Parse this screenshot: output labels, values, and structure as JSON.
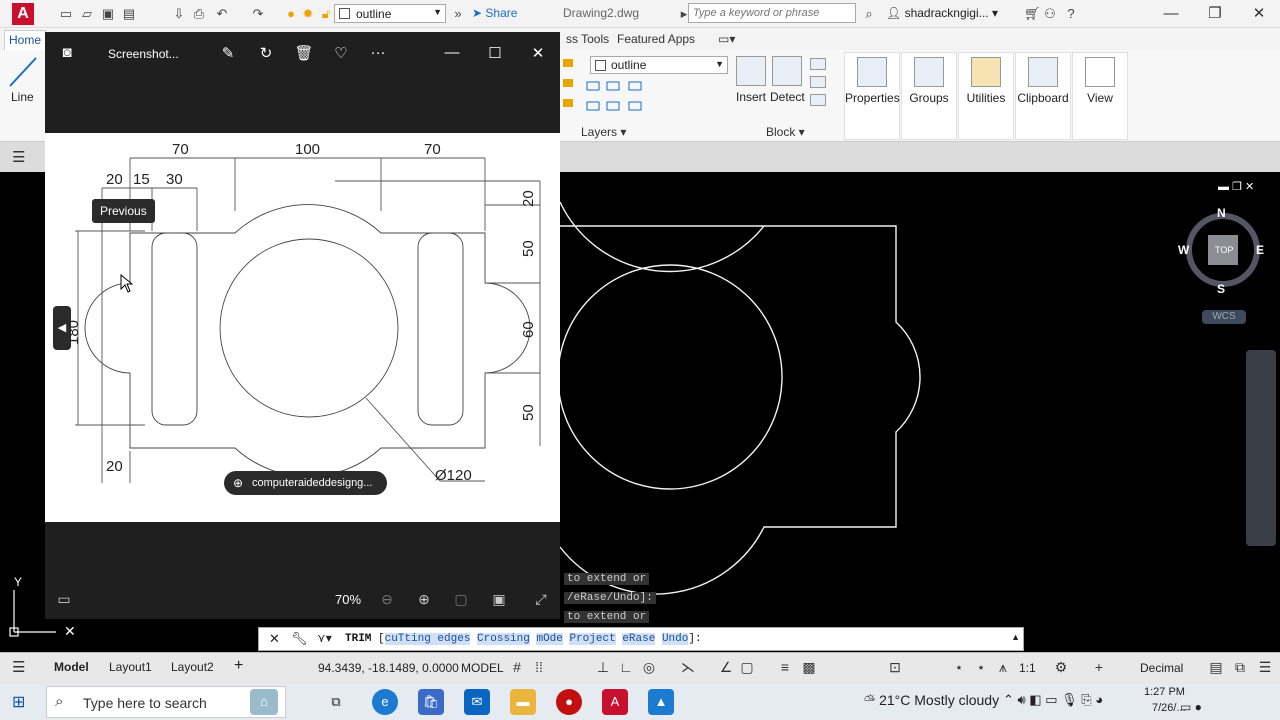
{
  "titlebar": {
    "logo": "A",
    "workspace": "outline",
    "share_label": "Share",
    "doc_title": "Drawing2.dwg",
    "search_placeholder": "Type a keyword or phrase",
    "user": "shadrackngigi..."
  },
  "ribbon": {
    "tabs": [
      "Home",
      "ss Tools",
      "Featured Apps"
    ],
    "line_label": "Line",
    "layer_current": "outline",
    "layers_caption": "Layers",
    "block_caption": "Block",
    "buttons": [
      "Insert",
      "Detect",
      "Properties",
      "Groups",
      "Utilities",
      "Clipboard",
      "View"
    ]
  },
  "viewer": {
    "title": "Screenshot...",
    "tooltip": "Previous",
    "source_chip": "computeraideddesigng...",
    "zoom": "70%",
    "dims": {
      "top_70a": "70",
      "top_100": "100",
      "top_70b": "70",
      "d20": "20",
      "d15": "15",
      "d30": "30",
      "r20": "20",
      "r50a": "50",
      "r60": "60",
      "r50b": "50",
      "left_dim": "180",
      "bottom_20": "20",
      "dia": "Ø120"
    }
  },
  "command": {
    "history": [
      "to extend or",
      "/eRase/Undo]:",
      "to extend or"
    ],
    "prompt_cmd": "TRIM",
    "keywords": [
      "cuTting edges",
      "Crossing",
      "mOde",
      "Project",
      "eRase",
      "Undo"
    ]
  },
  "statusbar": {
    "tabs": [
      "Model",
      "Layout1",
      "Layout2"
    ],
    "coords": "94.3439, -18.1489, 0.0000",
    "model": "MODEL",
    "scale": "1:1",
    "units": "Decimal"
  },
  "compass": {
    "n": "N",
    "s": "S",
    "e": "E",
    "w": "W",
    "top": "TOP",
    "wcs": "WCS"
  },
  "taskbar": {
    "search_placeholder": "Type here to search",
    "weather": "21°C  Mostly cloudy",
    "time": "1:27 PM",
    "date": "7/26/..."
  }
}
